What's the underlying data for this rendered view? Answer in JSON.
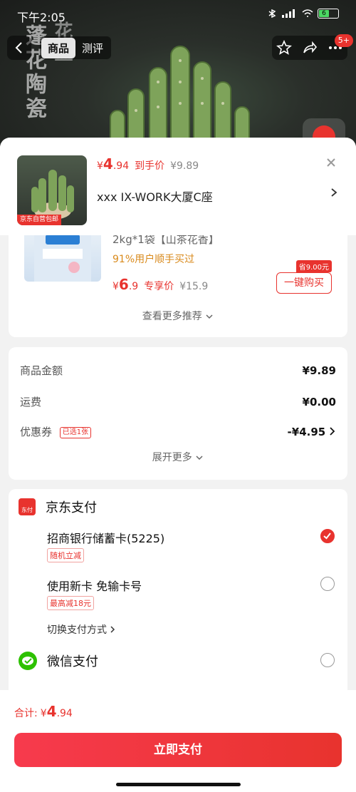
{
  "statusbar": {
    "time": "下午2:05",
    "battery": "6"
  },
  "bg": {
    "vertical_text_1": "蓬花陶瓷",
    "vertical_text_2": "花盆",
    "tabs": [
      "商品",
      "测评"
    ],
    "badge": "5+"
  },
  "sheet": {
    "product": {
      "thumb_text": "蓬花陶瓷",
      "thumb_label": "京东自营包邮",
      "price_symbol": "¥",
      "price_int": "4",
      "price_dec": ".94",
      "price_label": "到手价",
      "original_price": "¥9.89"
    },
    "address": "xxx  IX-WORK大厦C座"
  },
  "recommend": {
    "title": "2kg*1袋【山茶花香】",
    "pct": "91%用户顺手买过",
    "price_symbol": "¥",
    "price_int": "6",
    "price_dec": ".9",
    "price_label": "专享价",
    "original_price": "¥15.9",
    "save_tag": "省9.00元",
    "buy_label": "一键购买",
    "more_label": "查看更多推荐"
  },
  "summary": {
    "rows": [
      {
        "label": "商品金额",
        "value": "¥9.89"
      },
      {
        "label": "运费",
        "value": "¥0.00"
      },
      {
        "label": "优惠券",
        "tag": "已选1张",
        "value": "-¥4.95"
      }
    ],
    "expand_label": "展开更多"
  },
  "payment": {
    "jd": {
      "title": "京东支付",
      "icon_text": "东付",
      "options": [
        {
          "label": "招商银行储蓄卡(5225)",
          "tag": "随机立减",
          "selected": true
        },
        {
          "label": "使用新卡 免输卡号",
          "tag": "最高减18元",
          "selected": false
        }
      ],
      "switch_label": "切换支付方式"
    },
    "wechat": {
      "title": "微信支付",
      "selected": false
    }
  },
  "footer": {
    "total_label": "合计:",
    "total_symbol": "¥",
    "total_int": "4",
    "total_dec": ".94",
    "pay_button": "立即支付"
  },
  "colors": {
    "accent": "#e8332e",
    "wechat": "#2dc100",
    "orange_text": "#d98a1c"
  }
}
